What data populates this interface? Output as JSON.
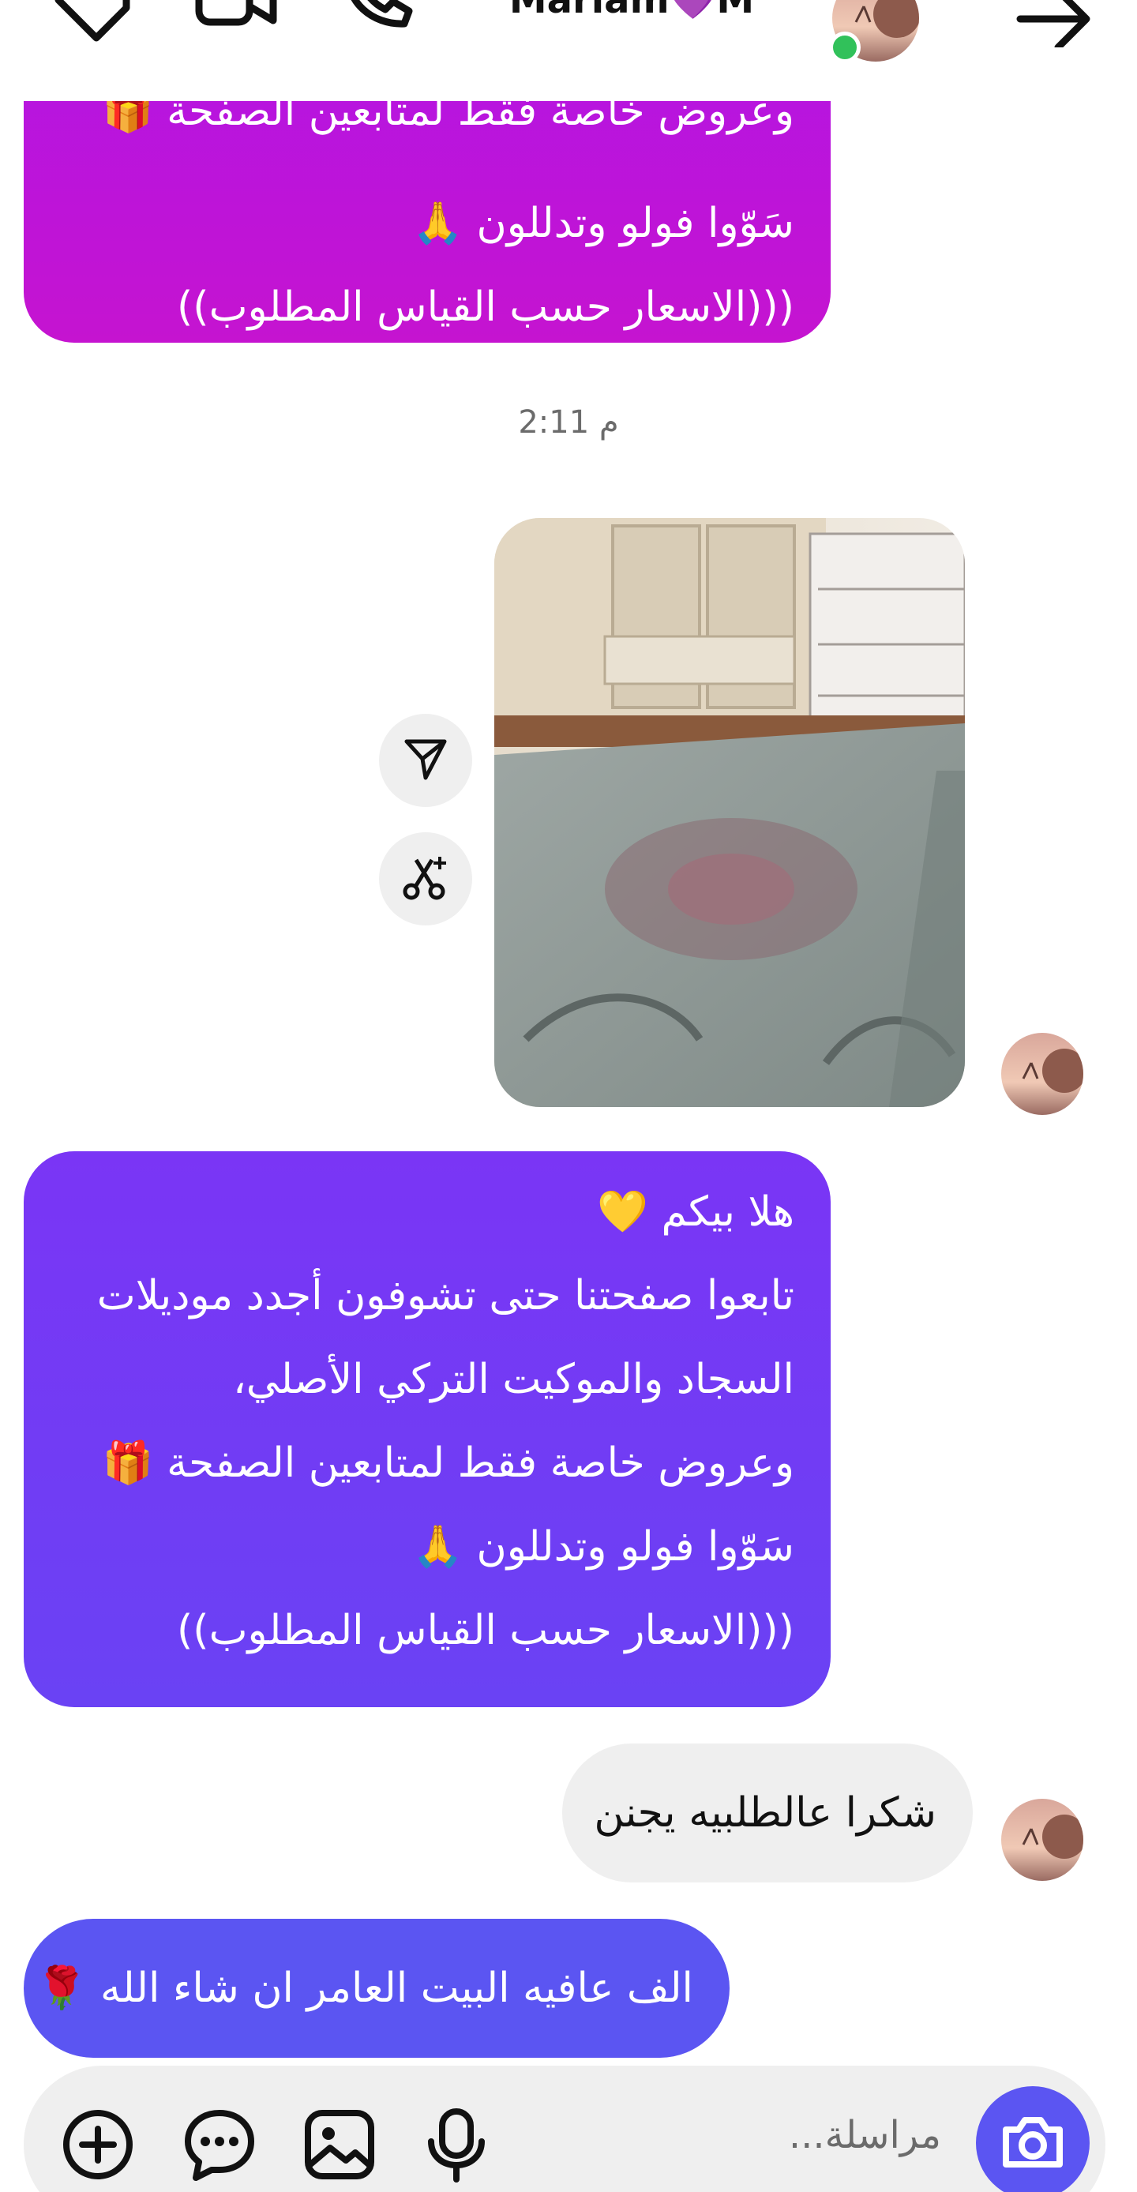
{
  "header": {
    "title": "Mariam💜M",
    "icons": [
      "tag-icon",
      "video-call-icon",
      "phone-icon",
      "arrow-right-icon"
    ],
    "online_color": "#31c15a"
  },
  "messages": {
    "first_bubble": {
      "lines": [
        "وعروض خاصة فقط لمتابعين الصفحة 🎁",
        "سَوّوا فولو وتدللون 🙏",
        "(((الاسعار حسب القياس المطلوب))"
      ]
    },
    "timestamp": "2:11 م",
    "second_bubble": {
      "lines": [
        "هلا بيكم 💛",
        "تابعوا صفحتنا حتى تشوفون أجدد موديلات",
        "السجاد والموكيت التركي الأصلي،",
        "وعروض خاصة فقط لمتابعين الصفحة 🎁",
        "سَوّوا فولو وتدللون 🙏",
        "(((الاسعار حسب القياس المطلوب))"
      ]
    },
    "reply_bubble": "شكرا عالطلبيه يجنن",
    "last_bubble": "الف عافيه البيت العامر ان شاء الله 🌹"
  },
  "composer": {
    "placeholder": "مراسلة...",
    "icons": [
      "add-icon",
      "chat-bubble-icon",
      "gallery-icon",
      "microphone-icon",
      "camera-icon"
    ]
  },
  "colors": {
    "magenta": "#c514d0",
    "purple": "#7a35f5",
    "blue": "#5b55f2",
    "grey_bubble": "#efefef"
  }
}
